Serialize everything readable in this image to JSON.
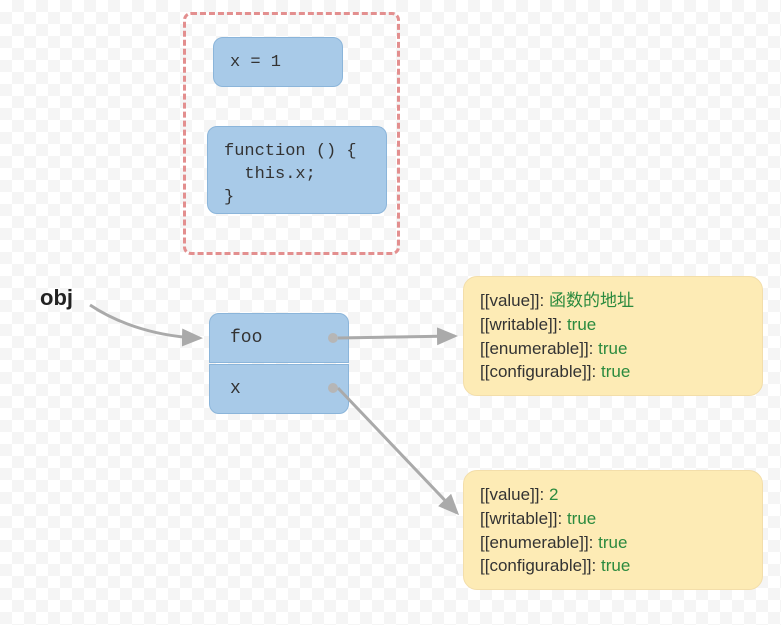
{
  "label": {
    "obj": "obj"
  },
  "boxes": {
    "x1": "x = 1",
    "fn": "function () {\n  this.x;\n}",
    "foo": "foo",
    "x": "x"
  },
  "descriptors": {
    "foo": {
      "value_key": "[[value]]:",
      "value_val": "函数的地址",
      "writable_key": "[[writable]]:",
      "writable_val": "true",
      "enumerable_key": "[[enumerable]]:",
      "enumerable_val": "true",
      "configurable_key": "[[configurable]]:",
      "configurable_val": "true"
    },
    "x": {
      "value_key": "[[value]]:",
      "value_val": "2",
      "writable_key": "[[writable]]:",
      "writable_val": "true",
      "enumerable_key": "[[enumerable]]:",
      "enumerable_val": "true",
      "configurable_key": "[[configurable]]:",
      "configurable_val": "true"
    }
  }
}
